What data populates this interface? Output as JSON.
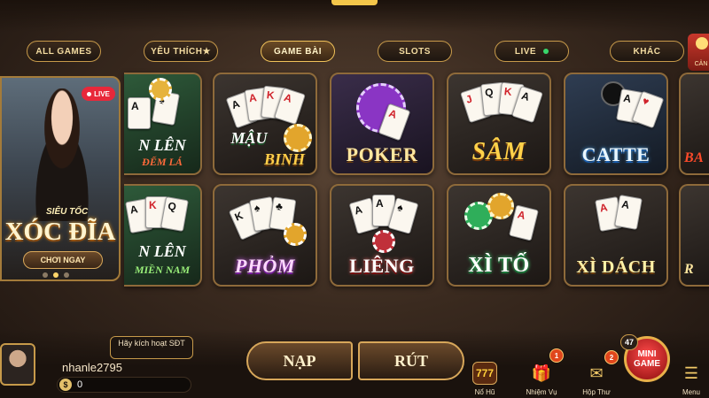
{
  "tabs": [
    {
      "label": "ALL GAMES"
    },
    {
      "label": "YÊU THÍCH★"
    },
    {
      "label": "GAME BÀI"
    },
    {
      "label": "SLOTS"
    },
    {
      "label": "LIVE"
    },
    {
      "label": "KHÁC"
    }
  ],
  "tab_edge_label": "CẢN",
  "active_tab": "GAME BÀI",
  "promo": {
    "live": "LIVE",
    "sub": "SIÊU TỐC",
    "title": "XÓC ĐĨA",
    "cta": "CHƠI NGAY"
  },
  "games": [
    {
      "label": "N LÊN",
      "label2": "ĐẾM LÁ"
    },
    {
      "label": "MẬU",
      "label2": "BINH"
    },
    {
      "label": "POKER"
    },
    {
      "label": "SÂM"
    },
    {
      "label": "CATTE"
    },
    {
      "label": "BA"
    },
    {
      "label": "N LÊN",
      "label2": "MIỀN NAM"
    },
    {
      "label": "PHỎM"
    },
    {
      "label": "LIÊNG"
    },
    {
      "label": "XÌ TỐ"
    },
    {
      "label": "XÌ DÁCH"
    },
    {
      "label": "R"
    }
  ],
  "user": {
    "activate": "Hãy kích hoạt SĐT",
    "name": "nhanle2795",
    "balance": "0",
    "coin_symbol": "$"
  },
  "actions": {
    "deposit": "NẠP",
    "withdraw": "RÚT"
  },
  "nav": [
    {
      "label": "Nổ Hũ",
      "icon": "jackpot-icon",
      "glyph": "777"
    },
    {
      "label": "Nhiệm Vụ",
      "icon": "gift-icon",
      "glyph": "🎁",
      "badge": "1"
    },
    {
      "label": "Hộp Thư",
      "icon": "mail-icon",
      "glyph": "✉",
      "badge": "2"
    },
    {
      "label": "Menu",
      "icon": "menu-icon",
      "glyph": "☰"
    }
  ],
  "mini_game": {
    "line1": "MINI",
    "line2": "GAME",
    "count": "47"
  }
}
